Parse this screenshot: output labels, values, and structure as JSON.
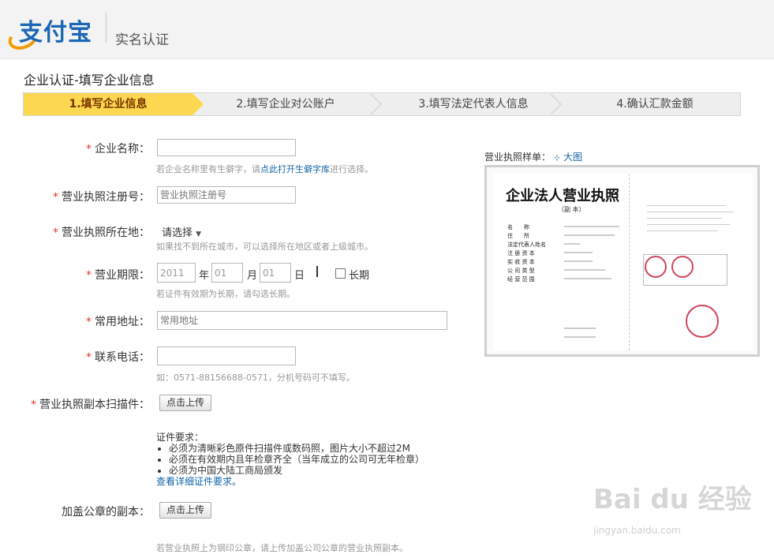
{
  "header": {
    "logo_text": "支付宝",
    "title": "实名认证"
  },
  "page_title": "企业认证-填写企业信息",
  "steps": [
    {
      "label": "1.填写企业信息"
    },
    {
      "label": "2.填写企业对公账户"
    },
    {
      "label": "3.填写法定代表人信息"
    },
    {
      "label": "4.确认汇款金额"
    }
  ],
  "form": {
    "company_name": {
      "label": "企业名称：",
      "value": "",
      "hint_prefix": "若企业名称里有生僻字，请",
      "hint_link": "点此打开生僻字库",
      "hint_suffix": "进行选择。"
    },
    "reg_number": {
      "label": "营业执照注册号：",
      "placeholder": "营业执照注册号"
    },
    "location": {
      "label": "营业执照所在地：",
      "select_label": "请选择",
      "hint": "如果找不到所在城市，可以选择所在地区或者上级城市。"
    },
    "term": {
      "label": "营业期限：",
      "year": "2011",
      "year_unit": "年",
      "month": "01",
      "month_unit": "月",
      "day": "01",
      "day_unit": "日",
      "long_term_label": "长期",
      "hint": "若证件有效期为长期，请勾选长期。"
    },
    "address": {
      "label": "常用地址：",
      "placeholder": "常用地址"
    },
    "phone": {
      "label": "联系电话：",
      "value": "",
      "hint": "如：0571-88156688-0571，分机号码可不填写。"
    },
    "scan": {
      "label": "营业执照副本扫描件：",
      "button": "点击上传"
    },
    "requirements": {
      "title": "证件要求：",
      "items": [
        "必须为清晰彩色原件扫描件或数码照，图片大小不超过2M",
        "必须在有效期内且年检章齐全（当年成立的公司可无年检章）",
        "必须为中国大陆工商局颁发"
      ],
      "link": "查看详细证件要求。"
    },
    "stamped_copy": {
      "label": "加盖公章的副本：",
      "button": "点击上传",
      "hint": "若营业执照上为钢印公章，请上传加盖公司公章的营业执照副本。"
    }
  },
  "sample": {
    "label": "营业执照样单：",
    "big_link": "大图",
    "doc_title": "企业法人营业执照",
    "doc_sub": "（副 本）",
    "rows": [
      "名　　称",
      "住　　所",
      "法定代表人姓名",
      "注 册 资 本",
      "实 收 资 本",
      "公 司 类 型",
      "经 营 范 围"
    ]
  },
  "watermark": {
    "brand": "Bai du 经验",
    "url": "jingyan.baidu.com"
  },
  "colors": {
    "step_active": "#fbd84f",
    "link": "#1464a5",
    "required": "#e0382b"
  }
}
